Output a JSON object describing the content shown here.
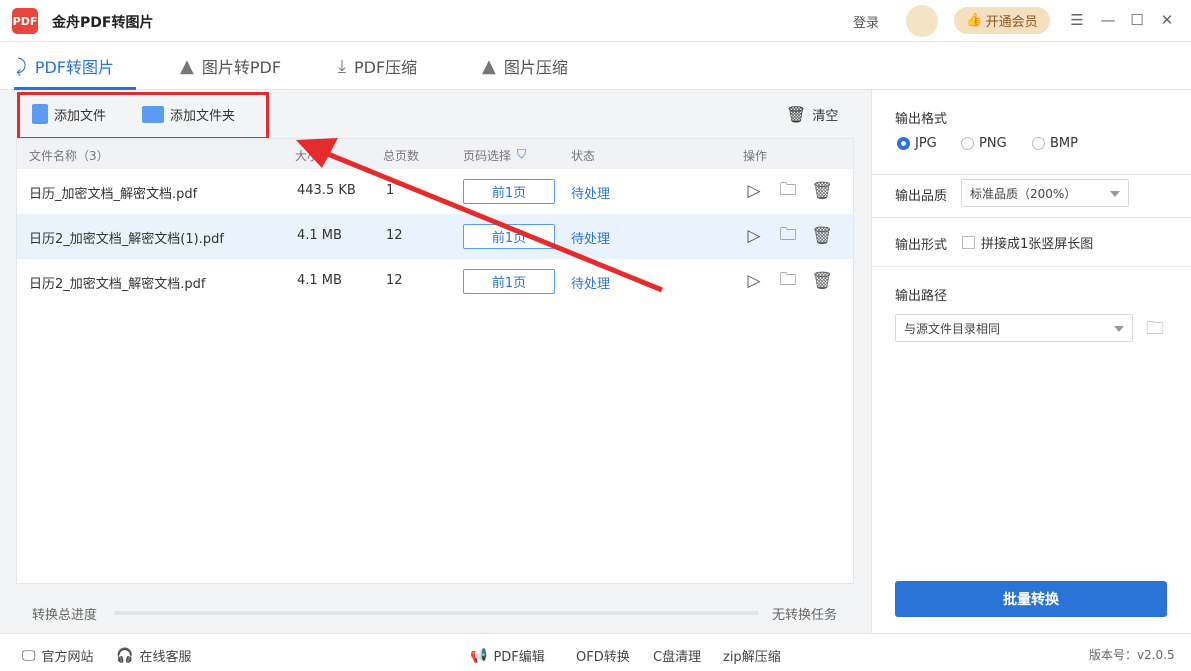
{
  "app": {
    "logo_text": "PDF",
    "title": "金舟PDF转图片"
  },
  "header": {
    "login": "登录",
    "vip_label": "开通会员",
    "vip_icon": "thumbs-up-icon"
  },
  "tabs": [
    {
      "label": "PDF转图片",
      "icon": "pdf-to-image-icon",
      "active": true
    },
    {
      "label": "图片转PDF",
      "icon": "image-to-pdf-icon",
      "active": false
    },
    {
      "label": "PDF压缩",
      "icon": "pdf-compress-icon",
      "active": false
    },
    {
      "label": "图片压缩",
      "icon": "image-compress-icon",
      "active": false
    }
  ],
  "toolbar": {
    "add_file": "添加文件",
    "add_folder": "添加文件夹",
    "clear": "清空"
  },
  "table": {
    "headers": {
      "name": "文件名称（3）",
      "size": "大小",
      "pages": "总页数",
      "page_select": "页码选择",
      "status": "状态",
      "actions": "操作"
    },
    "rows": [
      {
        "name": "日历_加密文档_解密文档.pdf",
        "size": "443.5 KB",
        "pages": "1",
        "page_select": "前1页",
        "status": "待处理",
        "selected": false
      },
      {
        "name": "日历2_加密文档_解密文档(1).pdf",
        "size": "4.1 MB",
        "pages": "12",
        "page_select": "前1页",
        "status": "待处理",
        "selected": true
      },
      {
        "name": "日历2_加密文档_解密文档.pdf",
        "size": "4.1 MB",
        "pages": "12",
        "page_select": "前1页",
        "status": "待处理",
        "selected": false
      }
    ]
  },
  "progress": {
    "label": "转换总进度",
    "status": "无转换任务",
    "value": 0
  },
  "settings": {
    "format_label": "输出格式",
    "formats": [
      {
        "label": "JPG",
        "selected": true
      },
      {
        "label": "PNG",
        "selected": false
      },
      {
        "label": "BMP",
        "selected": false
      }
    ],
    "quality_label": "输出品质",
    "quality_value": "标准品质（200%）",
    "form_label": "输出形式",
    "form_option": "拼接成1张竖屏长图",
    "path_label": "输出路径",
    "path_value": "与源文件目录相同",
    "convert_button": "批量转换"
  },
  "footer": {
    "website": "官方网站",
    "service": "在线客服",
    "pdf_edit": "PDF编辑",
    "ofd": "OFD转换",
    "c_clean": "C盘清理",
    "zip": "zip解压缩",
    "version": "版本号：v2.0.5"
  },
  "colors": {
    "accent": "#2a74d8",
    "highlight_box": "#e52b2b",
    "selected_row": "#eaf3fc"
  }
}
